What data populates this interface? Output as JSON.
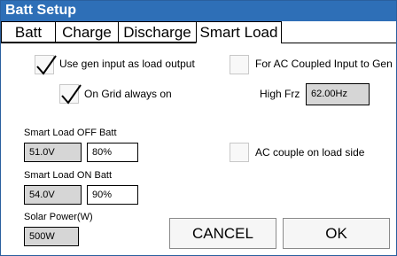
{
  "window": {
    "title": "Batt Setup"
  },
  "tabs": [
    "Batt",
    "Charge",
    "Discharge",
    "Smart Load"
  ],
  "active_tab": "Smart Load",
  "options": {
    "use_gen_input": {
      "label": "Use gen input as load output",
      "checked": true
    },
    "ac_coupled_input_gen": {
      "label": "For AC Coupled Input to Gen",
      "checked": false
    },
    "on_grid_always_on": {
      "label": "On Grid always on",
      "checked": true
    },
    "ac_couple_load_side": {
      "label": "AC couple on load side",
      "checked": false
    }
  },
  "high_frz": {
    "label": "High Frz",
    "value": "62.00Hz"
  },
  "smart_load_off": {
    "label": "Smart Load OFF Batt",
    "voltage": "51.0V",
    "percent": "80%"
  },
  "smart_load_on": {
    "label": "Smart Load ON Batt",
    "voltage": "54.0V",
    "percent": "90%"
  },
  "solar_power": {
    "label": "Solar Power(W)",
    "value": "500W"
  },
  "buttons": {
    "cancel": "CANCEL",
    "ok": "OK"
  }
}
